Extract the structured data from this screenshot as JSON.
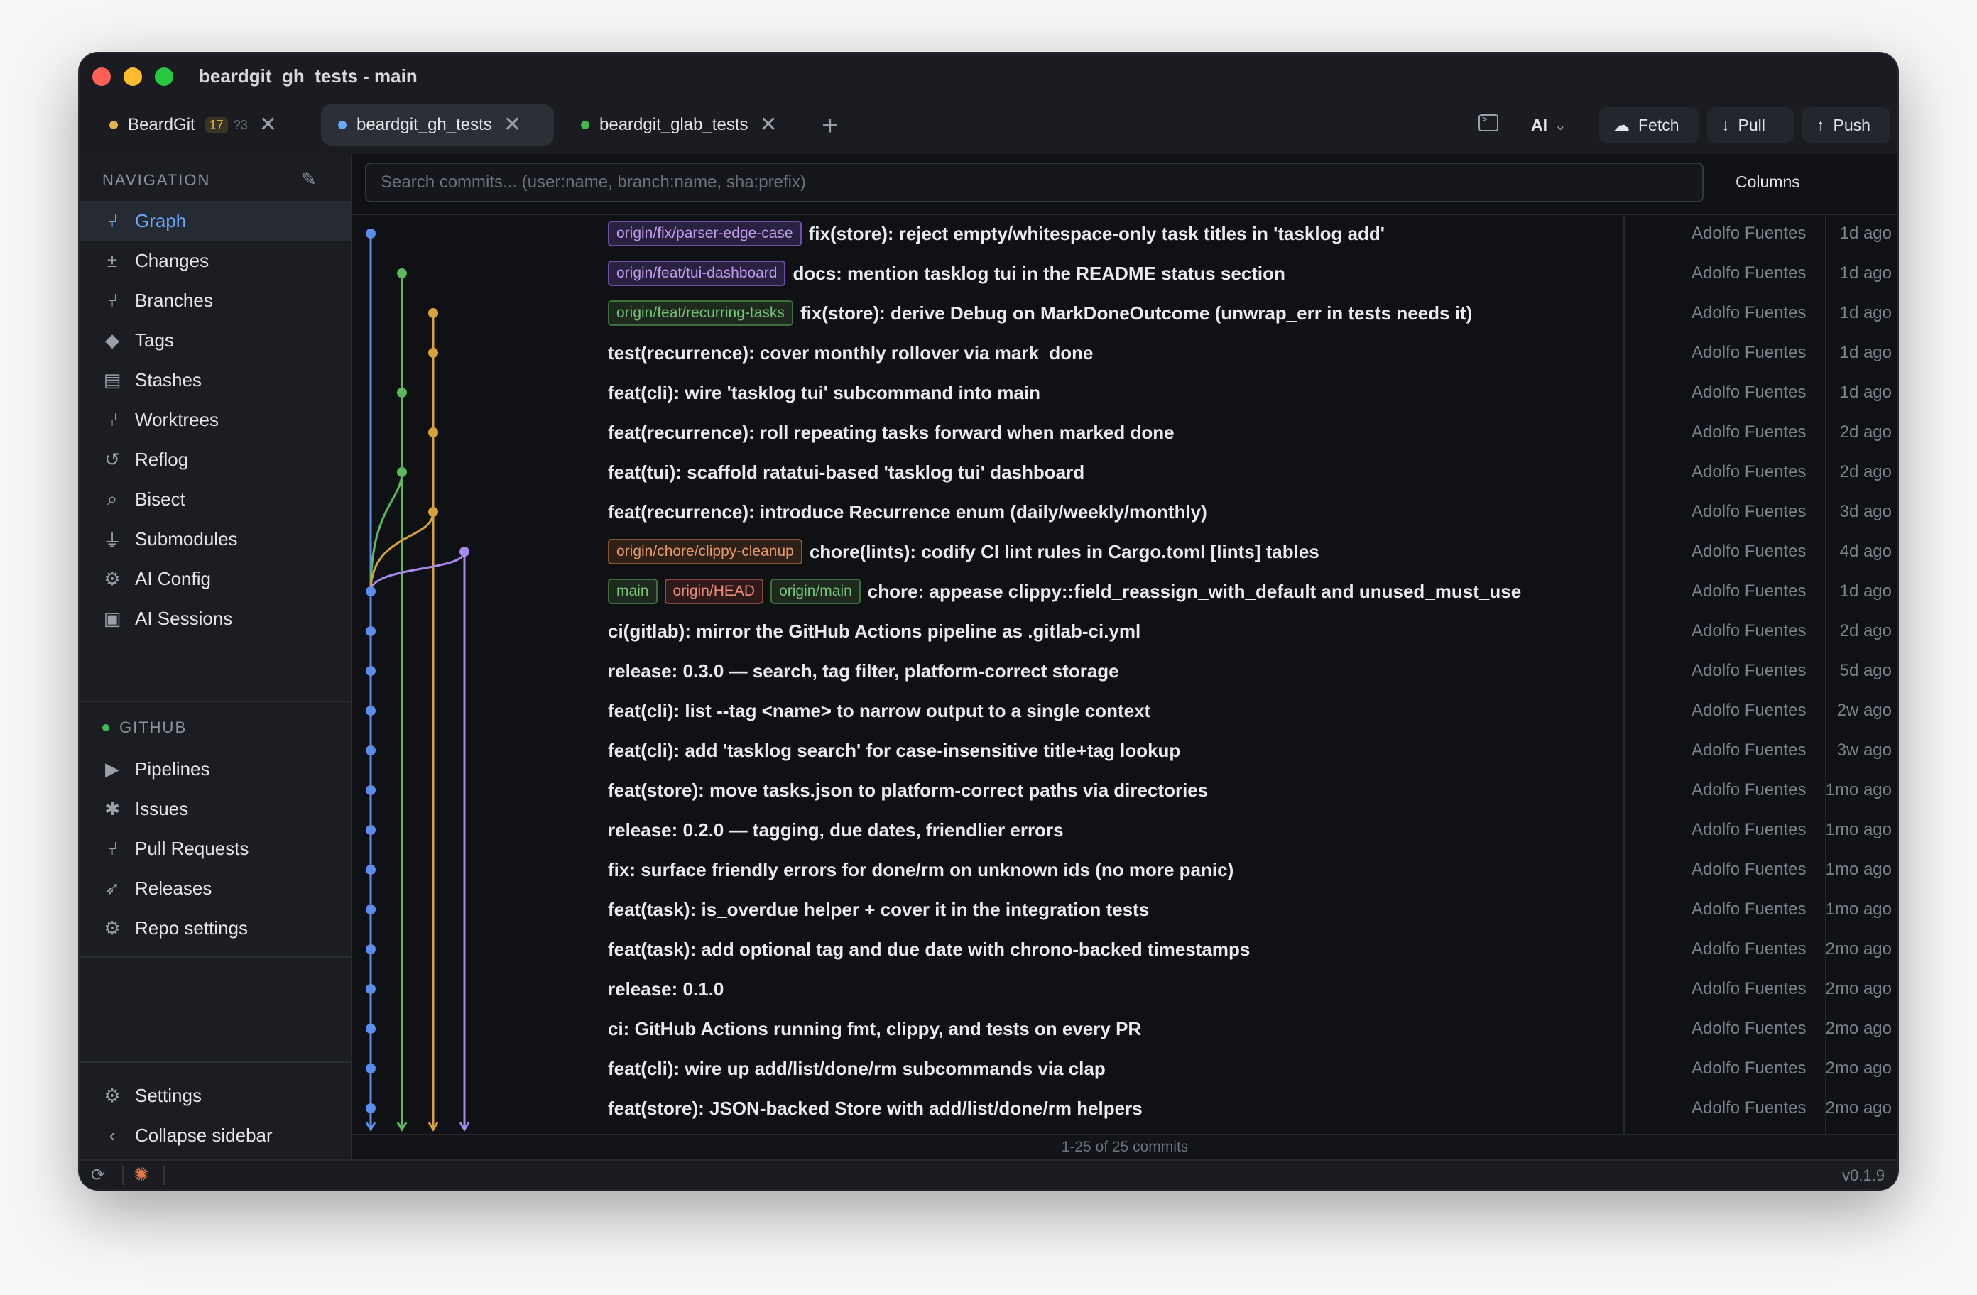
{
  "window": {
    "title": "beardgit_gh_tests - main"
  },
  "tabs": [
    {
      "label": "BeardGit",
      "badge_modified": "17",
      "badge_untracked": "?3",
      "dot_color": "#e4b44c"
    },
    {
      "label": "beardgit_gh_tests",
      "dot_color": "#6aa8ff"
    },
    {
      "label": "beardgit_glab_tests",
      "dot_color": "#3fb950"
    }
  ],
  "toolbar": {
    "ai_label": "AI",
    "fetch_label": "Fetch",
    "pull_label": "Pull",
    "push_label": "Push"
  },
  "sidebar": {
    "nav_header": "NAVIGATION",
    "nav_items": [
      {
        "label": "Graph",
        "icon": "graph-icon",
        "glyph": "⑂"
      },
      {
        "label": "Changes",
        "icon": "changes-icon",
        "glyph": "±"
      },
      {
        "label": "Branches",
        "icon": "branch-icon",
        "glyph": "⑂"
      },
      {
        "label": "Tags",
        "icon": "tag-icon",
        "glyph": "◆"
      },
      {
        "label": "Stashes",
        "icon": "stash-icon",
        "glyph": "▤"
      },
      {
        "label": "Worktrees",
        "icon": "worktree-icon",
        "glyph": "⑂"
      },
      {
        "label": "Reflog",
        "icon": "history-icon",
        "glyph": "↺"
      },
      {
        "label": "Bisect",
        "icon": "search-icon",
        "glyph": "⌕"
      },
      {
        "label": "Submodules",
        "icon": "plug-icon",
        "glyph": "⏚"
      },
      {
        "label": "AI Config",
        "icon": "ai-config-icon",
        "glyph": "⚙"
      },
      {
        "label": "AI Sessions",
        "icon": "terminal-icon",
        "glyph": "▣"
      }
    ],
    "github_header": "GITHUB",
    "github_items": [
      {
        "label": "Pipelines",
        "icon": "play-icon",
        "glyph": "▶"
      },
      {
        "label": "Issues",
        "icon": "bug-icon",
        "glyph": "✱"
      },
      {
        "label": "Pull Requests",
        "icon": "pull-request-icon",
        "glyph": "⑂"
      },
      {
        "label": "Releases",
        "icon": "rocket-icon",
        "glyph": "➶"
      },
      {
        "label": "Repo settings",
        "icon": "gear-icon",
        "glyph": "⚙"
      }
    ],
    "settings_label": "Settings",
    "collapse_label": "Collapse sidebar"
  },
  "search": {
    "placeholder": "Search commits... (user:name, branch:name, sha:prefix)"
  },
  "columns_label": "Columns",
  "commits": [
    {
      "refs": [
        {
          "label": "origin/fix/parser-edge-case",
          "style": "purple"
        }
      ],
      "message": "fix(store): reject empty/whitespace-only task titles in 'tasklog add'",
      "author": "Adolfo Fuentes",
      "date": "1d ago"
    },
    {
      "refs": [
        {
          "label": "origin/feat/tui-dashboard",
          "style": "purple"
        }
      ],
      "message": "docs: mention tasklog tui in the README status section",
      "author": "Adolfo Fuentes",
      "date": "1d ago"
    },
    {
      "refs": [
        {
          "label": "origin/feat/recurring-tasks",
          "style": "green"
        }
      ],
      "message": "fix(store): derive Debug on MarkDoneOutcome (unwrap_err in tests needs it)",
      "author": "Adolfo Fuentes",
      "date": "1d ago"
    },
    {
      "refs": [],
      "message": "test(recurrence): cover monthly rollover via mark_done",
      "author": "Adolfo Fuentes",
      "date": "1d ago"
    },
    {
      "refs": [],
      "message": "feat(cli): wire 'tasklog tui' subcommand into main",
      "author": "Adolfo Fuentes",
      "date": "1d ago"
    },
    {
      "refs": [],
      "message": "feat(recurrence): roll repeating tasks forward when marked done",
      "author": "Adolfo Fuentes",
      "date": "2d ago"
    },
    {
      "refs": [],
      "message": "feat(tui): scaffold ratatui-based 'tasklog tui' dashboard",
      "author": "Adolfo Fuentes",
      "date": "2d ago"
    },
    {
      "refs": [],
      "message": "feat(recurrence): introduce Recurrence enum (daily/weekly/monthly)",
      "author": "Adolfo Fuentes",
      "date": "3d ago"
    },
    {
      "refs": [
        {
          "label": "origin/chore/clippy-cleanup",
          "style": "orange"
        }
      ],
      "message": "chore(lints): codify CI lint rules in Cargo.toml [lints] tables",
      "author": "Adolfo Fuentes",
      "date": "4d ago"
    },
    {
      "refs": [
        {
          "label": "main",
          "style": "green"
        },
        {
          "label": "origin/HEAD",
          "style": "head"
        },
        {
          "label": "origin/main",
          "style": "green"
        }
      ],
      "message": "chore: appease clippy::field_reassign_with_default and unused_must_use",
      "author": "Adolfo Fuentes",
      "date": "1d ago"
    },
    {
      "refs": [],
      "message": "ci(gitlab): mirror the GitHub Actions pipeline as .gitlab-ci.yml",
      "author": "Adolfo Fuentes",
      "date": "2d ago"
    },
    {
      "refs": [],
      "message": "release: 0.3.0 — search, tag filter, platform-correct storage",
      "author": "Adolfo Fuentes",
      "date": "5d ago"
    },
    {
      "refs": [],
      "message": "feat(cli): list --tag <name> to narrow output to a single context",
      "author": "Adolfo Fuentes",
      "date": "2w ago"
    },
    {
      "refs": [],
      "message": "feat(cli): add 'tasklog search' for case-insensitive title+tag lookup",
      "author": "Adolfo Fuentes",
      "date": "3w ago"
    },
    {
      "refs": [],
      "message": "feat(store): move tasks.json to platform-correct paths via directories",
      "author": "Adolfo Fuentes",
      "date": "1mo ago"
    },
    {
      "refs": [],
      "message": "release: 0.2.0 — tagging, due dates, friendlier errors",
      "author": "Adolfo Fuentes",
      "date": "1mo ago"
    },
    {
      "refs": [],
      "message": "fix: surface friendly errors for done/rm on unknown ids (no more panic)",
      "author": "Adolfo Fuentes",
      "date": "1mo ago"
    },
    {
      "refs": [],
      "message": "feat(task): is_overdue helper + cover it in the integration tests",
      "author": "Adolfo Fuentes",
      "date": "1mo ago"
    },
    {
      "refs": [],
      "message": "feat(task): add optional tag and due date with chrono-backed timestamps",
      "author": "Adolfo Fuentes",
      "date": "2mo ago"
    },
    {
      "refs": [],
      "message": "release: 0.1.0",
      "author": "Adolfo Fuentes",
      "date": "2mo ago"
    },
    {
      "refs": [],
      "message": "ci: GitHub Actions running fmt, clippy, and tests on every PR",
      "author": "Adolfo Fuentes",
      "date": "2mo ago"
    },
    {
      "refs": [],
      "message": "feat(cli): wire up add/list/done/rm subcommands via clap",
      "author": "Adolfo Fuentes",
      "date": "2mo ago"
    },
    {
      "refs": [],
      "message": "feat(store): JSON-backed Store with add/list/done/rm helpers",
      "author": "Adolfo Fuentes",
      "date": "2mo ago"
    }
  ],
  "graph": {
    "lane_colors": [
      "#5b8def",
      "#5cb85c",
      "#d9a13b",
      "#a98bef"
    ],
    "commit_lanes": [
      0,
      1,
      2,
      2,
      1,
      2,
      1,
      2,
      3,
      0,
      0,
      0,
      0,
      0,
      0,
      0,
      0,
      0,
      0,
      0,
      0,
      0,
      0
    ]
  },
  "pagination": "1-25 of 25 commits",
  "version": "v0.1.9",
  "colors": {
    "accent": "#6aa8ff",
    "ref_purple": "#c09cf0",
    "ref_green": "#79c27a",
    "ref_orange": "#e89a6a",
    "ref_head": "#f08a7a"
  }
}
